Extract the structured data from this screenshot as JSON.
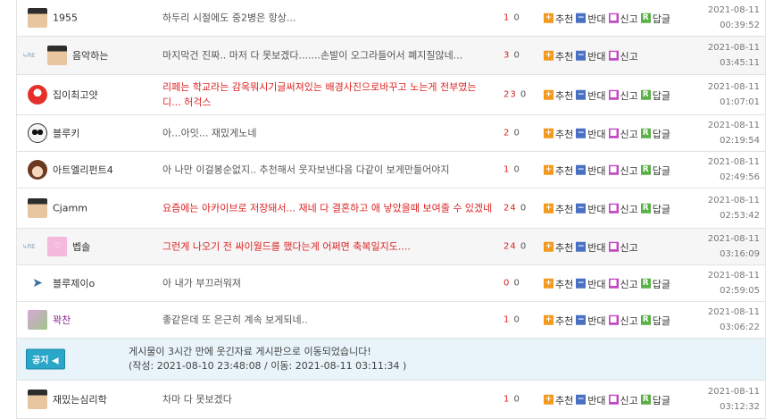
{
  "posts": [
    {
      "reply": false,
      "avatar": "person-icon",
      "nick": "1955",
      "title": "하두리 시절에도 중2병은 항상...",
      "title_red": false,
      "count": "1 0",
      "actions": [
        "추천",
        "반대",
        "신고",
        "답글"
      ],
      "date": "2021-08-11",
      "time": "00:39:52"
    },
    {
      "reply": true,
      "avatar": "person-icon",
      "nick": "음악하는",
      "title": "마지막건 진짜.. 마저 다 못보겠다.......손발이 오그라들어서 폐지질않네...",
      "title_red": false,
      "count": "3 0",
      "actions": [
        "추천",
        "반대",
        "신고"
      ],
      "date": "2021-08-11",
      "time": "03:45:11"
    },
    {
      "reply": false,
      "avatar": "red-avatar",
      "nick": "집이최고얏",
      "title": "리페는 학교라는 감옥뭐시기글써져있는 배경사진으로바꾸고 노는게 전부였는디... 허걱스",
      "title_red": true,
      "count": "23 0",
      "actions": [
        "추천",
        "반대",
        "신고",
        "답글"
      ],
      "date": "2021-08-11",
      "time": "01:07:01"
    },
    {
      "reply": false,
      "avatar": "panda-avatar",
      "nick": "블루키",
      "title": "아...아잇... 재밌게노네",
      "title_red": false,
      "count": "2 0",
      "actions": [
        "추천",
        "반대",
        "신고",
        "답글"
      ],
      "date": "2021-08-11",
      "time": "02:19:54"
    },
    {
      "reply": false,
      "avatar": "girl-avatar",
      "nick": "아트엘리펀트4",
      "title": "아 나만 이걸봉순없지.. 추천해서 웃자보낸다음 다같이 보게만들어야지",
      "title_red": false,
      "count": "1 0",
      "actions": [
        "추천",
        "반대",
        "신고",
        "답글"
      ],
      "date": "2021-08-11",
      "time": "02:49:56"
    },
    {
      "reply": false,
      "avatar": "person-icon",
      "nick": "Cjamm",
      "title": "요즘에는 아카이브로 저장돼서... 재네 다 결혼하고 애 낳았을때 보여줄 수 있겠네",
      "title_red": true,
      "count": "24 0",
      "actions": [
        "추천",
        "반대",
        "신고",
        "답글"
      ],
      "date": "2021-08-11",
      "time": "02:53:42"
    },
    {
      "reply": true,
      "avatar": "pink-avatar",
      "nick": "벱솔",
      "title": "그런게 나오기 전 싸이월드를 했다는게 어쩌면 축복일지도....",
      "title_red": true,
      "count": "24 0",
      "actions": [
        "추천",
        "반대",
        "신고"
      ],
      "date": "2021-08-11",
      "time": "03:16:09"
    },
    {
      "reply": false,
      "avatar": "bird-avatar",
      "nick": "블루제이o",
      "title": "아 내가 부끄러워져",
      "title_red": false,
      "count": "0 0",
      "actions": [
        "추천",
        "반대",
        "신고",
        "답글"
      ],
      "date": "2021-08-11",
      "time": "02:59:05"
    },
    {
      "reply": false,
      "avatar": "flower-avatar",
      "nick": "꽉찬",
      "nick_purple": true,
      "title": "좋같은데 또 은근히 계속 보게되네..",
      "title_red": false,
      "count": "1 0",
      "actions": [
        "추천",
        "반대",
        "신고",
        "답글"
      ],
      "date": "2021-08-11",
      "time": "03:06:22"
    }
  ],
  "notice": {
    "badge": "공지",
    "line1": "게시물이 3시간 만에 웃긴자료 게시판으로 이동되었습니다!",
    "line2": "(작성: 2021-08-10 23:48:08 / 이동: 2021-08-11 03:11:34 )"
  },
  "last_post": {
    "reply": false,
    "avatar": "person-icon",
    "nick": "재밌는심리학",
    "title": "차마 다 못보겠다",
    "title_red": false,
    "count": "1 0",
    "actions": [
      "추천",
      "반대",
      "신고",
      "답글"
    ],
    "date": "2021-08-11",
    "time": "03:12:32"
  }
}
